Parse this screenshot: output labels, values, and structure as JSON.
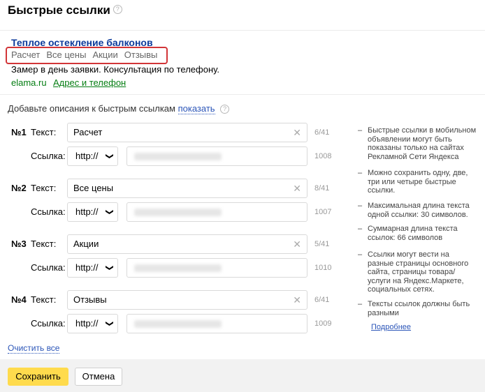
{
  "page": {
    "title": "Быстрые ссылки"
  },
  "preview": {
    "title": "Теплое остекление балконов",
    "links": [
      "Расчет",
      "Все цены",
      "Акции",
      "Отзывы"
    ],
    "description": "Замер в день заявки. Консультация по телефону.",
    "domain": "elama.ru",
    "address_link": "Адрес и телефон"
  },
  "add_descriptions": {
    "text": "Добавьте описания к быстрым ссылкам",
    "link": "показать"
  },
  "labels": {
    "text": "Текст:",
    "link": "Ссылка:"
  },
  "sitelinks": [
    {
      "num": "№1",
      "text": "Расчет",
      "counter": "6/41",
      "protocol": "http://",
      "link_counter": "1008"
    },
    {
      "num": "№2",
      "text": "Все цены",
      "counter": "8/41",
      "protocol": "http://",
      "link_counter": "1007"
    },
    {
      "num": "№3",
      "text": "Акции",
      "counter": "5/41",
      "protocol": "http://",
      "link_counter": "1010"
    },
    {
      "num": "№4",
      "text": "Отзывы",
      "counter": "6/41",
      "protocol": "http://",
      "link_counter": "1009"
    }
  ],
  "hints": [
    "Быстрые ссылки в мобильном объявлении могут быть показаны только на сайтах Рекламной Сети Яндекса",
    "Можно сохранить одну, две, три или четыре быстрые ссылки.",
    "Максимальная длина текста одной ссылки: 30 символов.",
    "Суммарная длина текста ссылок: 66 символов",
    "Ссылки могут вести на разные страницы основного сайта, страницы товара/услуги на Яндекс.Маркете, социальных сетях.",
    "Тексты ссылок должны быть разными"
  ],
  "hint_dash": "–",
  "more_link": "Подробнее",
  "clear_all": "Очистить все",
  "buttons": {
    "save": "Сохранить",
    "cancel": "Отмена"
  },
  "icons": {
    "help": "?",
    "clear": "✕",
    "chevron": "❯"
  }
}
